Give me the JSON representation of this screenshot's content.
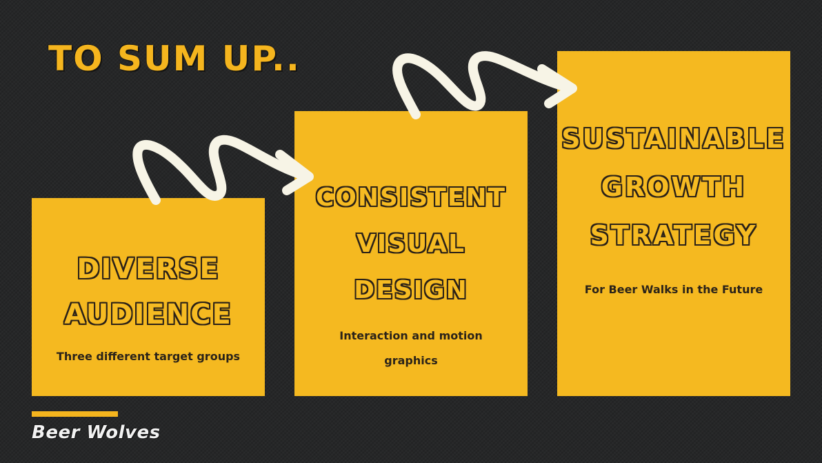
{
  "slide": {
    "title": "TO SUM UP..",
    "background_color": "#262728",
    "accent_color": "#f5b920"
  },
  "cards": [
    {
      "heading_lines": [
        "Diverse",
        "Audience"
      ],
      "subtitle": "Three different target groups"
    },
    {
      "heading_lines": [
        "Consistent",
        "Visual",
        "Design"
      ],
      "subtitle": "Interaction and motion graphics"
    },
    {
      "heading_lines": [
        "Sustainable",
        "Growth",
        "Strategy"
      ],
      "subtitle": "For Beer Walks in the Future"
    }
  ],
  "arrows": [
    {
      "icon": "squiggle-arrow-icon",
      "color": "#f7f4e6"
    },
    {
      "icon": "squiggle-arrow-icon",
      "color": "#f7f4e6"
    }
  ],
  "footer": {
    "brand": "Beer Wolves"
  }
}
